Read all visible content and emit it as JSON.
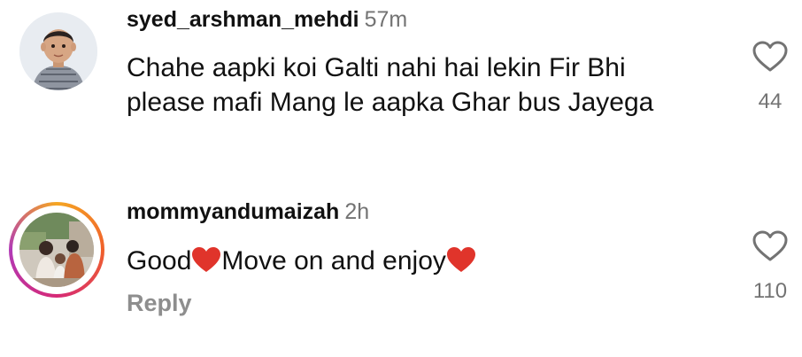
{
  "comments": [
    {
      "username": "syed_arshman_mehdi",
      "time": "57m",
      "text": "Chahe aapki koi Galti nahi hai lekin Fir Bhi please mafi Mang le aapka Ghar bus Jayega",
      "likes": "44",
      "avatar": "child-photo-avatar"
    },
    {
      "username": "mommyandumaizah",
      "time": "2h",
      "text_parts": [
        "Good",
        "Move on and enjoy"
      ],
      "likes": "110",
      "reply_label": "Reply",
      "avatar": "family-photo-avatar",
      "story_ring": true
    }
  ],
  "icons": {
    "like": "heart-outline-icon",
    "emoji": "red-heart-emoji"
  },
  "colors": {
    "text": "#111111",
    "secondary": "#737373",
    "reply": "#8e8e8e",
    "emoji_heart": "#e0342b",
    "story_ring": [
      "#f5a623",
      "#f0602b",
      "#d62976",
      "#b13ab7"
    ]
  }
}
